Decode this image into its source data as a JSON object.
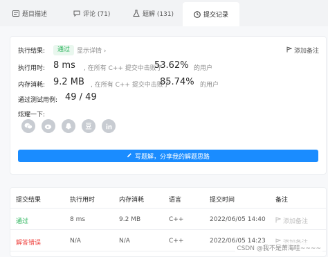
{
  "tabs": [
    {
      "label": "题目描述",
      "icon": "description-icon"
    },
    {
      "label": "评论 (71)",
      "icon": "comment-icon"
    },
    {
      "label": "题解 (131)",
      "icon": "flask-icon"
    },
    {
      "label": "提交记录",
      "icon": "clock-icon",
      "active": true
    }
  ],
  "result": {
    "status_label": "执行结果:",
    "status_value": "通过",
    "details_link": "显示详情 ›",
    "add_note": "添加备注",
    "runtime_label": "执行用时:",
    "runtime_value": "8 ms",
    "runtime_mid": ", 在所有 C++ 提交中击败了",
    "runtime_percent": "53.62%",
    "runtime_suffix": "的用户",
    "memory_label": "内存消耗:",
    "memory_value": "9.2 MB",
    "memory_mid": ", 在所有 C++ 提交中击败了",
    "memory_percent": "85.74%",
    "memory_suffix": "的用户",
    "tests_label": "通过测试用例:",
    "tests_value": "49 / 49",
    "share_label": "炫耀一下:",
    "share_icons": [
      "wechat-icon",
      "weibo-icon",
      "qq-icon",
      "douban-icon",
      "linkedin-icon"
    ],
    "solution_button": "写题解，分享我的解题思路"
  },
  "table": {
    "headers": [
      "提交结果",
      "执行用时",
      "内存消耗",
      "语言",
      "提交时间",
      "备注"
    ],
    "rows": [
      {
        "result": "通过",
        "runtime": "8 ms",
        "memory": "9.2 MB",
        "lang": "C++",
        "time": "2022/06/05 14:40",
        "note": "添加备注"
      },
      {
        "result": "解答错误",
        "runtime": "N/A",
        "memory": "N/A",
        "lang": "C++",
        "time": "2022/06/05 14:23",
        "note": "添加备注"
      }
    ]
  },
  "watermark": "CSDN @我不是萧海哇~~~~"
}
